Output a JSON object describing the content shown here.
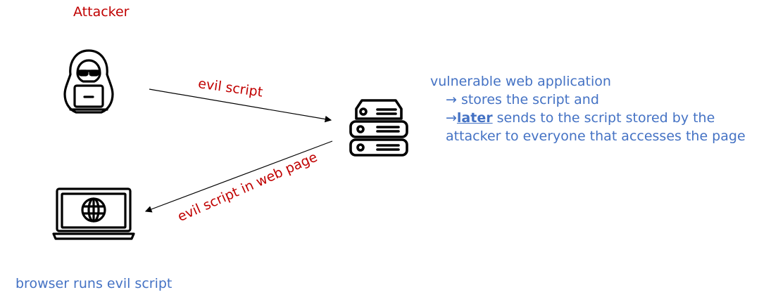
{
  "attacker": {
    "label": "Attacker",
    "icon": "hacker-icon"
  },
  "server": {
    "icon": "server-icon",
    "title": "vulnerable web application",
    "lines": [
      "→ stores the script and",
      "later",
      " sends to the script stored by the",
      "attacker to everyone that accesses the page"
    ],
    "arrow_prefix": "→"
  },
  "browser": {
    "label": "browser runs evil script",
    "icon": "laptop-globe-icon"
  },
  "flows": {
    "attacker_to_server": "evil script",
    "server_to_browser": "evil script in web page"
  },
  "colors": {
    "red": "#c00000",
    "blue": "#4472c4",
    "icon": "#000000"
  }
}
